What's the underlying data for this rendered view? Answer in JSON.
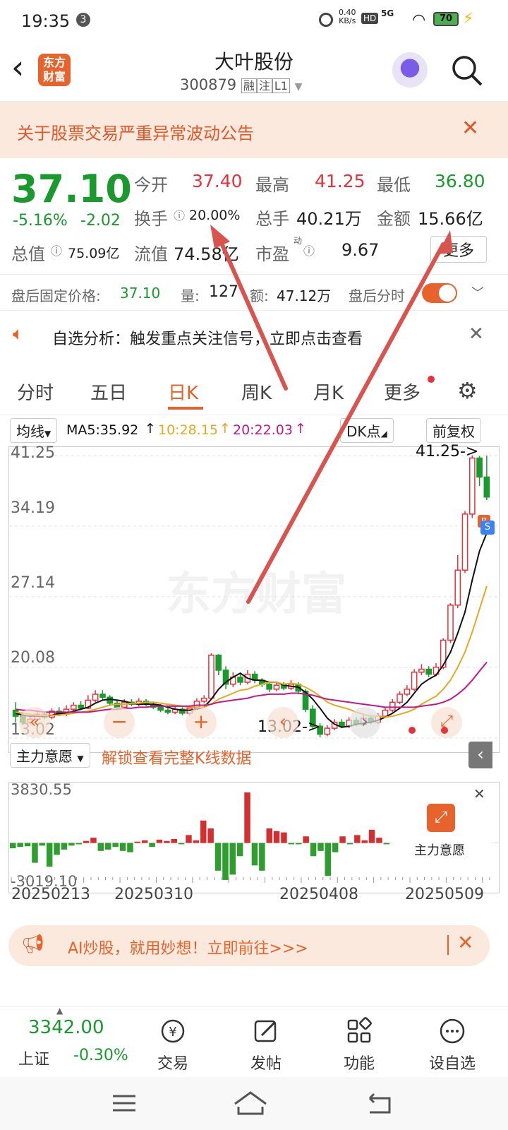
{
  "status": {
    "time": "19:35",
    "badge": "3",
    "net_speed": "0.40",
    "net_unit": "KB/s",
    "hd": "HD",
    "signal": "5G",
    "battery": "70"
  },
  "header": {
    "logo_line1": "东方",
    "logo_line2": "财富",
    "stock_name": "大叶股份",
    "stock_code": "300879",
    "tag1": "融",
    "tag2": "注",
    "tag3": "L1"
  },
  "notice": {
    "text": "关于股票交易严重异常波动公告"
  },
  "quote": {
    "price": "37.10",
    "change_pct": "-5.16%",
    "change": "-2.02",
    "open_label": "今开",
    "open": "37.40",
    "high_label": "最高",
    "high": "41.25",
    "low_label": "最低",
    "low": "36.80",
    "turnover_label": "换手",
    "turnover": "20.00%",
    "volume_label": "总手",
    "volume": "40.21万",
    "amount_label": "金额",
    "amount": "15.66亿",
    "mktcap_label": "总值",
    "mktcap": "75.09亿",
    "float_label": "流值",
    "float": "74.58亿",
    "pe_label": "市盈",
    "pe_sup": "动",
    "pe": "9.67",
    "more": "更多"
  },
  "afterhours": {
    "price_label": "盘后固定价格:",
    "price": "37.10",
    "vol_label": "量:",
    "vol": "127",
    "amt_label": "额:",
    "amt": "47.12万",
    "toggle_label": "盘后分时"
  },
  "alert": {
    "text": "自选分析：触发重点关注信号，立即点击查看"
  },
  "tabs": [
    "分时",
    "五日",
    "日K",
    "周K",
    "月K",
    "更多"
  ],
  "ma": {
    "selector": "均线",
    "ma5": "MA5:35.92",
    "ma10": "10:28.15",
    "ma20": "20:22.03",
    "dk": "DK点",
    "adjust": "前复权"
  },
  "chart_data": {
    "type": "candlestick",
    "yticks": [
      "41.25",
      "34.19",
      "27.14",
      "20.08",
      "13.02"
    ],
    "ylim": [
      13.02,
      41.25
    ],
    "max_label": "41.25->",
    "min_label": "13.02->",
    "watermark": "东方财富",
    "candles": [
      [
        15.8,
        15.2,
        16.6,
        14.6
      ],
      [
        15.2,
        14.6,
        15.6,
        14.3
      ],
      [
        14.6,
        14.9,
        15.3,
        14.4
      ],
      [
        14.9,
        15.4,
        15.8,
        14.7
      ],
      [
        15.4,
        15.1,
        15.7,
        14.9
      ],
      [
        15.1,
        15.7,
        16.0,
        14.9
      ],
      [
        15.7,
        15.4,
        16.1,
        15.2
      ],
      [
        15.4,
        15.9,
        16.3,
        15.2
      ],
      [
        15.9,
        16.3,
        16.6,
        15.7
      ],
      [
        16.3,
        16.0,
        16.7,
        15.8
      ],
      [
        16.0,
        16.8,
        17.3,
        15.9
      ],
      [
        16.8,
        17.4,
        17.8,
        16.6
      ],
      [
        17.4,
        17.1,
        17.8,
        16.8
      ],
      [
        17.1,
        16.5,
        17.3,
        16.2
      ],
      [
        16.5,
        16.1,
        16.8,
        15.9
      ],
      [
        16.1,
        16.6,
        16.9,
        15.9
      ],
      [
        16.6,
        16.4,
        16.9,
        16.2
      ],
      [
        16.4,
        16.7,
        17.0,
        16.2
      ],
      [
        16.7,
        16.4,
        16.9,
        16.2
      ],
      [
        16.4,
        16.1,
        16.6,
        15.9
      ],
      [
        16.1,
        15.8,
        16.4,
        15.6
      ],
      [
        15.8,
        15.6,
        16.0,
        15.4
      ],
      [
        15.6,
        15.9,
        16.2,
        15.4
      ],
      [
        15.9,
        15.5,
        16.1,
        15.3
      ],
      [
        15.5,
        16.0,
        16.3,
        15.3
      ],
      [
        16.0,
        16.7,
        17.0,
        15.9
      ],
      [
        16.7,
        17.0,
        17.3,
        16.5
      ],
      [
        17.0,
        21.3,
        21.5,
        16.9
      ],
      [
        21.3,
        19.8,
        21.4,
        19.3
      ],
      [
        19.8,
        18.4,
        20.2,
        17.9
      ],
      [
        18.4,
        19.1,
        19.6,
        18.1
      ],
      [
        19.1,
        18.6,
        19.5,
        18.3
      ],
      [
        18.6,
        19.4,
        19.8,
        18.4
      ],
      [
        19.4,
        18.8,
        19.7,
        18.5
      ],
      [
        18.8,
        18.4,
        19.0,
        18.1
      ],
      [
        18.4,
        17.9,
        18.6,
        17.6
      ],
      [
        17.9,
        18.3,
        18.6,
        17.7
      ],
      [
        18.3,
        18.0,
        18.6,
        17.8
      ],
      [
        18.0,
        18.4,
        18.8,
        17.8
      ],
      [
        18.4,
        17.7,
        18.6,
        17.4
      ],
      [
        17.7,
        15.9,
        17.9,
        15.6
      ],
      [
        15.9,
        14.2,
        16.3,
        13.9
      ],
      [
        14.2,
        13.4,
        14.5,
        13.1
      ],
      [
        13.4,
        14.0,
        14.3,
        13.2
      ],
      [
        14.0,
        14.6,
        14.9,
        13.8
      ],
      [
        14.6,
        14.2,
        14.9,
        14.0
      ],
      [
        14.2,
        14.8,
        15.1,
        14.0
      ],
      [
        14.8,
        14.4,
        15.1,
        14.2
      ],
      [
        14.4,
        15.0,
        15.3,
        14.2
      ],
      [
        15.0,
        14.6,
        15.3,
        14.4
      ],
      [
        14.6,
        15.2,
        15.5,
        14.4
      ],
      [
        15.2,
        15.8,
        16.1,
        15.0
      ],
      [
        15.8,
        16.6,
        16.9,
        15.6
      ],
      [
        16.6,
        17.4,
        17.7,
        16.4
      ],
      [
        17.4,
        17.9,
        18.3,
        17.2
      ],
      [
        17.9,
        19.6,
        19.9,
        17.7
      ],
      [
        19.6,
        19.9,
        20.4,
        19.3
      ],
      [
        19.9,
        19.4,
        20.2,
        19.1
      ],
      [
        19.4,
        20.1,
        20.5,
        19.2
      ],
      [
        20.1,
        22.8,
        23.0,
        19.9
      ],
      [
        22.8,
        26.3,
        26.5,
        22.5
      ],
      [
        26.3,
        29.8,
        31.3,
        26.0
      ],
      [
        29.8,
        35.4,
        35.7,
        29.5
      ],
      [
        35.4,
        41.0,
        41.25,
        35.0
      ],
      [
        41.0,
        39.1,
        41.2,
        38.2
      ],
      [
        39.1,
        37.1,
        41.25,
        36.8
      ]
    ],
    "ma5": [
      15.5,
      15.3,
      15.2,
      15.2,
      15.2,
      15.3,
      15.5,
      15.5,
      15.7,
      15.9,
      16.1,
      16.5,
      16.8,
      16.9,
      16.8,
      16.7,
      16.5,
      16.4,
      16.4,
      16.4,
      16.3,
      16.1,
      15.9,
      15.8,
      15.8,
      15.9,
      16.1,
      16.9,
      17.9,
      18.6,
      19.1,
      19.5,
      19.0,
      18.8,
      18.8,
      18.6,
      18.6,
      18.3,
      18.2,
      18.1,
      17.6,
      16.9,
      16.0,
      15.0,
      14.4,
      14.1,
      14.2,
      14.4,
      14.5,
      14.6,
      14.8,
      15.1,
      15.5,
      16.0,
      16.6,
      17.5,
      18.4,
      18.9,
      19.3,
      20.3,
      21.6,
      23.5,
      25.6,
      28.8,
      31.7,
      33.5
    ],
    "ma10": [
      15.6,
      15.5,
      15.4,
      15.3,
      15.3,
      15.3,
      15.3,
      15.4,
      15.5,
      15.6,
      15.7,
      15.9,
      16.1,
      16.3,
      16.4,
      16.4,
      16.5,
      16.5,
      16.6,
      16.6,
      16.5,
      16.4,
      16.3,
      16.2,
      16.1,
      16.1,
      16.1,
      16.4,
      16.9,
      17.2,
      17.5,
      17.8,
      17.9,
      18.2,
      18.4,
      18.6,
      18.6,
      18.4,
      18.5,
      18.4,
      18.1,
      17.7,
      17.2,
      16.6,
      16.3,
      16.1,
      15.9,
      15.6,
      15.4,
      15.2,
      15.2,
      15.1,
      15.2,
      15.4,
      15.6,
      15.9,
      16.4,
      16.8,
      17.2,
      17.9,
      18.8,
      20.1,
      21.6,
      23.6,
      25.9,
      28.2
    ],
    "ma20": [
      15.9,
      15.8,
      15.8,
      15.7,
      15.6,
      15.6,
      15.6,
      15.6,
      15.6,
      15.6,
      15.6,
      15.7,
      15.8,
      15.9,
      15.9,
      16.0,
      16.0,
      16.1,
      16.1,
      16.2,
      16.2,
      16.2,
      16.2,
      16.2,
      16.2,
      16.3,
      16.3,
      16.4,
      16.6,
      16.7,
      16.8,
      16.9,
      17.0,
      17.2,
      17.3,
      17.4,
      17.4,
      17.4,
      17.5,
      17.5,
      17.4,
      17.3,
      17.1,
      16.9,
      16.8,
      16.7,
      16.6,
      16.5,
      16.4,
      16.3,
      16.2,
      16.1,
      16.1,
      16.1,
      16.1,
      16.1,
      16.2,
      16.3,
      16.4,
      16.6,
      16.9,
      17.4,
      18.0,
      18.8,
      19.7,
      20.6
    ]
  },
  "zlyy": {
    "selector": "主力意愿",
    "promo": "解锁查看完整K线数据",
    "max": "3830.55",
    "min": "-3019.10",
    "badge": "主力意愿",
    "values": [
      -400,
      -300,
      -250,
      -1500,
      -200,
      -1800,
      -900,
      -500,
      -200,
      -100,
      150,
      400,
      -600,
      -500,
      -300,
      -600,
      -700,
      100,
      200,
      -300,
      250,
      150,
      300,
      -100,
      600,
      200,
      1700,
      1100,
      -2100,
      -2800,
      -2400,
      -1000,
      3830,
      -1700,
      -2100,
      1100,
      900,
      800,
      -100,
      -100,
      500,
      -1000,
      -600,
      -2500,
      -700,
      500,
      -100,
      600,
      200,
      1000,
      400,
      -100
    ]
  },
  "xaxis": {
    "d1": "20250213",
    "d2": "20250310",
    "d3": "20250408",
    "d4": "20250509"
  },
  "ad": {
    "text": "AI炒股，就用妙想！立即前往>>>"
  },
  "index": {
    "value": "3342.00",
    "name": "上证",
    "change": "-0.30%"
  },
  "nav": {
    "trade": "交易",
    "post": "发帖",
    "func": "功能",
    "watch": "设自选"
  },
  "colors": {
    "up": "#e5323b",
    "down": "#1a9a2e",
    "accent": "#e5632b",
    "arrow": "#d9534f"
  }
}
